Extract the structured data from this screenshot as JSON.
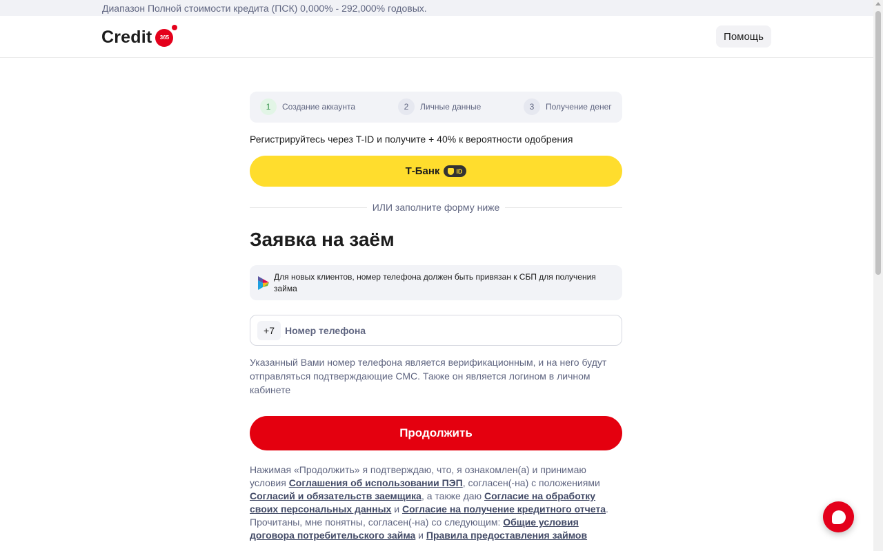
{
  "top_banner": {
    "text": "Диапазон Полной стоимости кредита (ПСК) 0,000% - 292,000% годовых."
  },
  "header": {
    "logo_text": "Credit",
    "logo_badge": "365",
    "help_label": "Помощь"
  },
  "steps": [
    {
      "number": "1",
      "label": "Создание аккаунта",
      "active": true
    },
    {
      "number": "2",
      "label": "Личные данные",
      "active": false
    },
    {
      "number": "3",
      "label": "Получение денег",
      "active": false
    }
  ],
  "tid": {
    "promo_text": "Регистрируйтесь через T-ID и получите + 40% к вероятности одобрения",
    "button_label": "Т-Банк",
    "badge_label": "ID"
  },
  "divider_text": "ИЛИ заполните форму ниже",
  "form": {
    "title": "Заявка на заём",
    "sbp_notice": "Для новых клиентов, номер телефона должен быть привязан к СБП для получения займа",
    "phone_prefix": "+7",
    "phone_placeholder": "Номер телефона",
    "phone_value": "",
    "hint": "Указанный Вами номер телефона является верификационным, и на него будут отправляться подтверждающие СМС. Также он является логином в личном кабинете",
    "continue_label": "Продолжить"
  },
  "legal": {
    "t1": "Нажимая «Продолжить» я подтверждаю, что, я ознакомлен(а) и принимаю условия ",
    "link1": "Соглашения об использовании ПЭП",
    "t2": ", согласен(-на) с положениями ",
    "link2": "Согласий и обязательств заемщика",
    "t3": ", а также даю ",
    "link3": "Согласие на обработку своих персональных данных",
    "t4": " и ",
    "link4": "Согласие на получение кредитного отчета",
    "t5": ". Прочитаны, мне понятны, согласен(-на) со следующим: ",
    "link5": "Общие условия договора потребительского займа",
    "t6": " и ",
    "link6": "Правила предоставления займов"
  },
  "colors": {
    "brand_red": "#e4001b",
    "tbank_yellow": "#ffdd2d",
    "muted_text": "#5f6580",
    "panel_bg": "#f2f3f7"
  },
  "icons": {
    "chat": "chat-icon",
    "sbp": "sbp-logo-icon",
    "tid_shield": "shield-icon"
  }
}
